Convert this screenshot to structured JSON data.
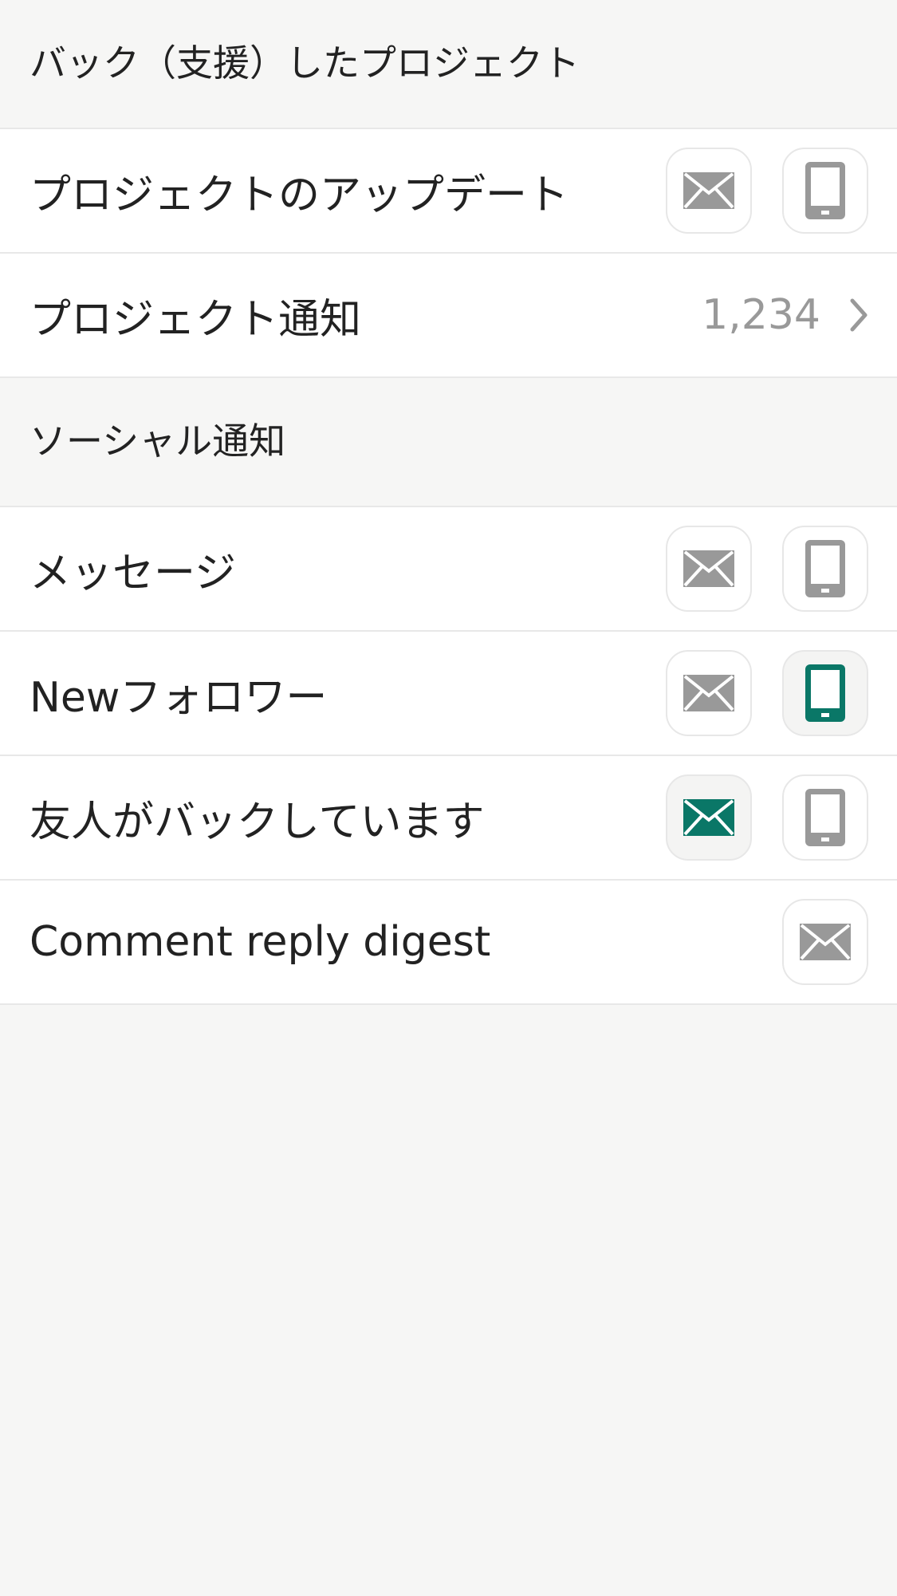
{
  "colors": {
    "accent": "#0a7767",
    "icon_off": "#999999",
    "background": "#f6f6f5"
  },
  "sections": [
    {
      "title": "バック（支援）したプロジェクト"
    },
    {
      "title": "ソーシャル通知"
    }
  ],
  "rows": {
    "project_updates": {
      "label": "プロジェクトのアップデート",
      "email": "off",
      "phone": "off"
    },
    "project_notifications": {
      "label": "プロジェクト通知",
      "count": "1,234",
      "icon": "chevron-right-icon"
    },
    "messages": {
      "label": "メッセージ",
      "email": "off",
      "phone": "off"
    },
    "new_followers": {
      "label": "Newフォロワー",
      "email": "off",
      "phone": "on"
    },
    "friends_backing": {
      "label": "友人がバックしています",
      "email": "on",
      "phone": "off"
    },
    "comment_reply_digest": {
      "label": "Comment reply digest",
      "email": "off"
    }
  },
  "icons": {
    "email": "envelope-icon",
    "phone": "phone-icon"
  }
}
